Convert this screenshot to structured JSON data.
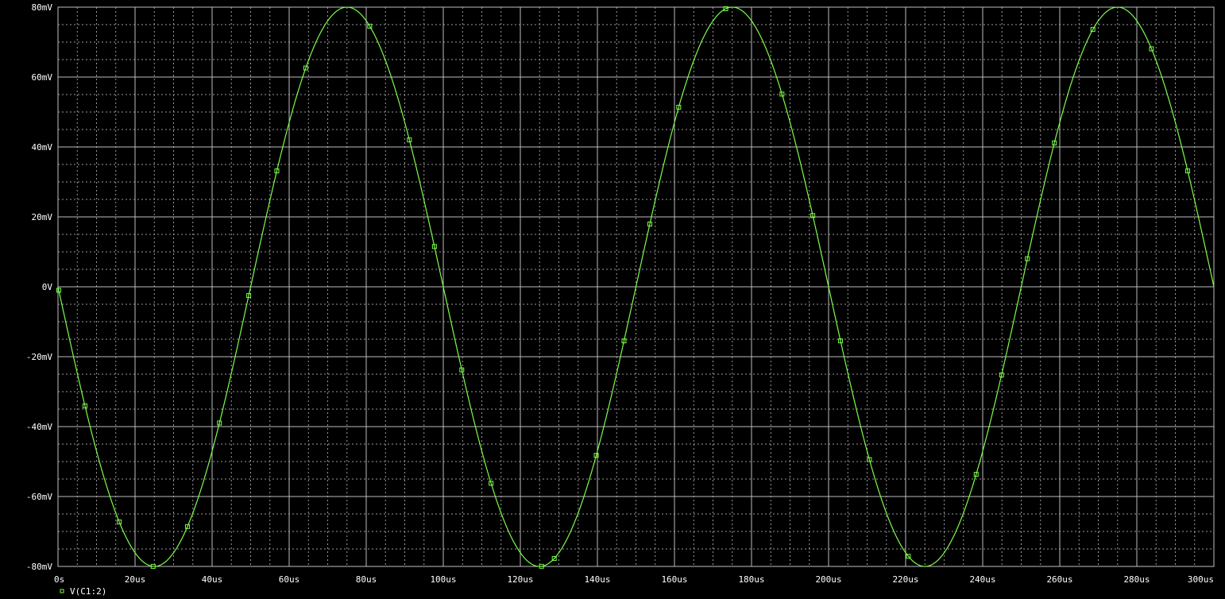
{
  "chart_data": {
    "type": "line",
    "title": "",
    "xlabel": "",
    "ylabel": "",
    "xlim": [
      0,
      300
    ],
    "ylim": [
      -80,
      80
    ],
    "x_unit": "us",
    "y_unit": "mV",
    "x_ticks": [
      0,
      20,
      40,
      60,
      80,
      100,
      120,
      140,
      160,
      180,
      200,
      220,
      240,
      260,
      280,
      300
    ],
    "x_tick_labels": [
      "0s",
      "20us",
      "40us",
      "60us",
      "80us",
      "100us",
      "120us",
      "140us",
      "160us",
      "180us",
      "200us",
      "220us",
      "240us",
      "260us",
      "280us",
      "300us"
    ],
    "y_ticks": [
      80,
      60,
      40,
      20,
      0,
      -20,
      -40,
      -60,
      -80
    ],
    "y_tick_labels": [
      "80mV",
      "60mV",
      "40mV",
      "20mV",
      "0V",
      "-20mV",
      "-40mV",
      "-60mV",
      "-80mV"
    ],
    "grid": true,
    "legend_position": "bottom-left",
    "series": [
      {
        "name": "V(C1:2)",
        "color": "#7CFC4A",
        "marker": "square",
        "amplitude_mV": 80,
        "period_us": 100,
        "x": [
          0,
          5,
          10,
          15,
          20,
          25,
          30,
          35,
          40,
          45,
          50,
          55,
          60,
          65,
          70,
          75,
          80,
          85,
          90,
          95,
          100,
          105,
          110,
          115,
          120,
          125,
          130,
          135,
          140,
          145,
          150,
          155,
          160,
          165,
          170,
          175,
          180,
          185,
          190,
          195,
          200,
          205,
          210,
          215,
          220,
          225,
          230,
          235,
          240,
          245,
          250,
          255,
          260,
          265,
          270,
          275,
          280,
          285,
          290,
          295,
          300
        ],
        "y": [
          0,
          -24.7,
          -47.0,
          -64.7,
          -76.1,
          -80,
          -76.1,
          -64.7,
          -47.0,
          -24.7,
          0,
          24.7,
          47.0,
          64.7,
          76.1,
          80,
          76.1,
          64.7,
          47.0,
          24.7,
          0,
          -24.7,
          -47.0,
          -64.7,
          -76.1,
          -80,
          -76.1,
          -64.7,
          -47.0,
          -24.7,
          0,
          24.7,
          47.0,
          64.7,
          76.1,
          80,
          76.1,
          64.7,
          47.0,
          24.7,
          0,
          -24.7,
          -47.0,
          -64.7,
          -76.1,
          -80,
          -76.1,
          -64.7,
          -47.0,
          -24.7,
          0,
          24.7,
          47.0,
          64.7,
          76.1,
          80,
          76.1,
          64.7,
          47.0,
          24.7,
          0
        ],
        "marker_x": [
          0.2,
          7.0,
          15.9,
          24.7,
          33.6,
          41.9,
          49.5,
          56.8,
          64.3,
          80.9,
          91.2,
          97.7,
          104.8,
          112.4,
          125.5,
          128.8,
          139.7,
          146.9,
          153.6,
          161.1,
          173.3,
          187.9,
          195.9,
          203.1,
          210.6,
          220.7,
          238.3,
          244.9,
          251.6,
          258.6,
          268.6,
          283.8,
          293.2
        ]
      }
    ]
  }
}
